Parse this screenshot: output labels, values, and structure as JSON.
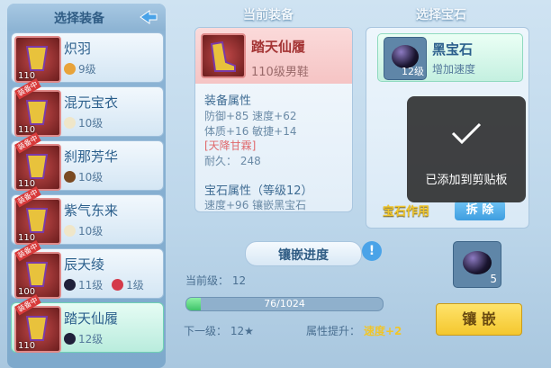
{
  "headers": {
    "select_equip": "选择装备",
    "current_equip": "当前装备",
    "select_gem": "选择宝石"
  },
  "equip_list": [
    {
      "name": "炽羽",
      "level": "110",
      "costs": [
        {
          "text": "9级",
          "ore": "orange"
        }
      ],
      "badge": ""
    },
    {
      "name": "混元宝衣",
      "level": "110",
      "costs": [
        {
          "text": "10级",
          "ore": "white"
        }
      ],
      "badge": "装备中"
    },
    {
      "name": "刹那芳华",
      "level": "110",
      "costs": [
        {
          "text": "10级",
          "ore": "brown"
        }
      ],
      "badge": "装备中"
    },
    {
      "name": "紫气东来",
      "level": "110",
      "costs": [
        {
          "text": "10级",
          "ore": "white"
        }
      ],
      "badge": "装备中"
    },
    {
      "name": "辰天绫",
      "level": "100",
      "costs": [
        {
          "text": "11级",
          "ore": "black"
        },
        {
          "text": "1级",
          "ore": "red"
        }
      ],
      "badge": "装备中"
    },
    {
      "name": "踏天仙履",
      "level": "110",
      "costs": [
        {
          "text": "12级",
          "ore": "black"
        }
      ],
      "badge": "装备中"
    }
  ],
  "current": {
    "name": "踏天仙履",
    "desc": "110级男鞋",
    "attr_title": "装备属性",
    "attr_line1": "防御+85 速度+62",
    "attr_line2": "体质+16 敏捷+14",
    "special": "[天降甘霖]",
    "durability": "耐久： 248",
    "gem_attr_title": "宝石属性（等级12）",
    "gem_attr_line": "速度+96 镶嵌黑宝石"
  },
  "gem": {
    "name": "黑宝石",
    "level": "12级",
    "effect": "增加速度",
    "effect_tag": "宝石作用",
    "remove_label": "拆 除"
  },
  "toast": {
    "text": "已添加到剪贴板"
  },
  "inlay": {
    "title": "镶嵌进度",
    "current_level": "当前级：  12",
    "progress_text": "76/1024",
    "progress_fraction": 0.074,
    "next_level": "下一级： 12★",
    "boost_label": "属性提升：",
    "boost_value": "速度+2",
    "slot_count": "5",
    "button_label": "镶 嵌"
  },
  "colors": {
    "accent_teal": "#6fd1b4",
    "button_yellow": "#f4c72e",
    "remove_blue": "#3f9ee0"
  }
}
